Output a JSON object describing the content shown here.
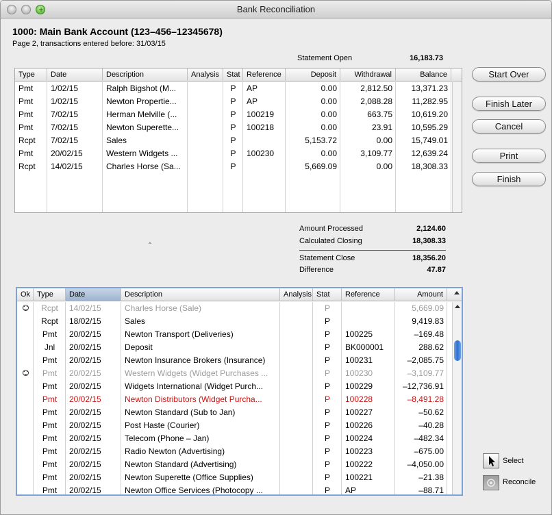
{
  "window": {
    "title": "Bank Reconciliation"
  },
  "account": {
    "title": "1000: Main Bank Account (123–456–12345678)",
    "subtitle": "Page 2, transactions entered before: 31/03/15"
  },
  "statement_open": {
    "label": "Statement Open",
    "value": "16,183.73"
  },
  "top_table": {
    "columns": [
      "Type",
      "Date",
      "Description",
      "Analysis",
      "Stat",
      "Reference",
      "Deposit",
      "Withdrawal",
      "Balance"
    ],
    "rows": [
      [
        "Pmt",
        "1/02/15",
        "Ralph Bigshot (M...",
        "",
        "P",
        "AP",
        "0.00",
        "2,812.50",
        "13,371.23"
      ],
      [
        "Pmt",
        "1/02/15",
        "Newton Propertie...",
        "",
        "P",
        "AP",
        "0.00",
        "2,088.28",
        "11,282.95"
      ],
      [
        "Pmt",
        "7/02/15",
        "Herman Melville (...",
        "",
        "P",
        "100219",
        "0.00",
        "663.75",
        "10,619.20"
      ],
      [
        "Pmt",
        "7/02/15",
        "Newton Superette...",
        "",
        "P",
        "100218",
        "0.00",
        "23.91",
        "10,595.29"
      ],
      [
        "Rcpt",
        "7/02/15",
        "Sales",
        "",
        "P",
        "",
        "5,153.72",
        "0.00",
        "15,749.01"
      ],
      [
        "Pmt",
        "20/02/15",
        "Western Widgets ...",
        "",
        "P",
        "100230",
        "0.00",
        "3,109.77",
        "12,639.24"
      ],
      [
        "Rcpt",
        "14/02/15",
        "Charles Horse (Sa...",
        "",
        "P",
        "",
        "5,669.09",
        "0.00",
        "18,308.33"
      ]
    ]
  },
  "buttons": {
    "start_over": "Start Over",
    "finish_later": "Finish Later",
    "cancel": "Cancel",
    "print": "Print",
    "finish": "Finish"
  },
  "summary": {
    "amount_processed": {
      "label": "Amount Processed",
      "value": "2,124.60"
    },
    "calculated_closing": {
      "label": "Calculated Closing",
      "value": "18,308.33"
    },
    "statement_close": {
      "label": "Statement Close",
      "value": "18,356.20"
    },
    "difference": {
      "label": "Difference",
      "value": "47.87"
    }
  },
  "splitter_glyph": "ˆ",
  "bottom_table": {
    "columns": [
      "Ok",
      "Type",
      "Date",
      "Description",
      "Analysis",
      "Stat",
      "Reference",
      "Amount"
    ],
    "sorted_column": "Date",
    "rows": [
      {
        "ok": "happy",
        "type": "Rcpt",
        "date": "14/02/15",
        "desc": "Charles Horse (Sale)",
        "analysis": "",
        "stat": "P",
        "ref": "",
        "amount": "5,669.09",
        "style": "dim"
      },
      {
        "ok": "",
        "type": "Rcpt",
        "date": "18/02/15",
        "desc": "Sales",
        "analysis": "",
        "stat": "P",
        "ref": "",
        "amount": "9,419.83",
        "style": ""
      },
      {
        "ok": "",
        "type": "Pmt",
        "date": "20/02/15",
        "desc": "Newton Transport (Deliveries)",
        "analysis": "",
        "stat": "P",
        "ref": "100225",
        "amount": "–169.48",
        "style": ""
      },
      {
        "ok": "",
        "type": "Jnl",
        "date": "20/02/15",
        "desc": "Deposit",
        "analysis": "",
        "stat": "P",
        "ref": "BK000001",
        "amount": "288.62",
        "style": ""
      },
      {
        "ok": "",
        "type": "Pmt",
        "date": "20/02/15",
        "desc": "Newton Insurance Brokers (Insurance)",
        "analysis": "",
        "stat": "P",
        "ref": "100231",
        "amount": "–2,085.75",
        "style": ""
      },
      {
        "ok": "sad",
        "type": "Pmt",
        "date": "20/02/15",
        "desc": "Western Widgets (Widget Purchases ...",
        "analysis": "",
        "stat": "P",
        "ref": "100230",
        "amount": "–3,109.77",
        "style": "dim"
      },
      {
        "ok": "",
        "type": "Pmt",
        "date": "20/02/15",
        "desc": "Widgets International (Widget Purch...",
        "analysis": "",
        "stat": "P",
        "ref": "100229",
        "amount": "–12,736.91",
        "style": ""
      },
      {
        "ok": "",
        "type": "Pmt",
        "date": "20/02/15",
        "desc": "Newton Distributors (Widget Purcha...",
        "analysis": "",
        "stat": "P",
        "ref": "100228",
        "amount": "–8,491.28",
        "style": "red"
      },
      {
        "ok": "",
        "type": "Pmt",
        "date": "20/02/15",
        "desc": "Newton Standard (Sub to Jan)",
        "analysis": "",
        "stat": "P",
        "ref": "100227",
        "amount": "–50.62",
        "style": ""
      },
      {
        "ok": "",
        "type": "Pmt",
        "date": "20/02/15",
        "desc": "Post Haste (Courier)",
        "analysis": "",
        "stat": "P",
        "ref": "100226",
        "amount": "–40.28",
        "style": ""
      },
      {
        "ok": "",
        "type": "Pmt",
        "date": "20/02/15",
        "desc": "Telecom (Phone – Jan)",
        "analysis": "",
        "stat": "P",
        "ref": "100224",
        "amount": "–482.34",
        "style": ""
      },
      {
        "ok": "",
        "type": "Pmt",
        "date": "20/02/15",
        "desc": "Radio Newton (Advertising)",
        "analysis": "",
        "stat": "P",
        "ref": "100223",
        "amount": "–675.00",
        "style": ""
      },
      {
        "ok": "",
        "type": "Pmt",
        "date": "20/02/15",
        "desc": "Newton Standard (Advertising)",
        "analysis": "",
        "stat": "P",
        "ref": "100222",
        "amount": "–4,050.00",
        "style": ""
      },
      {
        "ok": "",
        "type": "Pmt",
        "date": "20/02/15",
        "desc": "Newton Superette (Office Supplies)",
        "analysis": "",
        "stat": "P",
        "ref": "100221",
        "amount": "–21.38",
        "style": ""
      },
      {
        "ok": "",
        "type": "Pmt",
        "date": "20/02/15",
        "desc": "Newton Office Services (Photocopy ...",
        "analysis": "",
        "stat": "P",
        "ref": "AP",
        "amount": "–88.71",
        "style": ""
      }
    ]
  },
  "tools": {
    "select": {
      "label": "Select",
      "icon": "pointer-arrow-icon"
    },
    "reconcile": {
      "label": "Reconcile",
      "icon": "reconcile-tool-icon"
    }
  },
  "colors": {
    "red_row": "#cc1111",
    "dim_row": "#9a9a9a",
    "scroll_thumb": "#2e6fd1"
  }
}
